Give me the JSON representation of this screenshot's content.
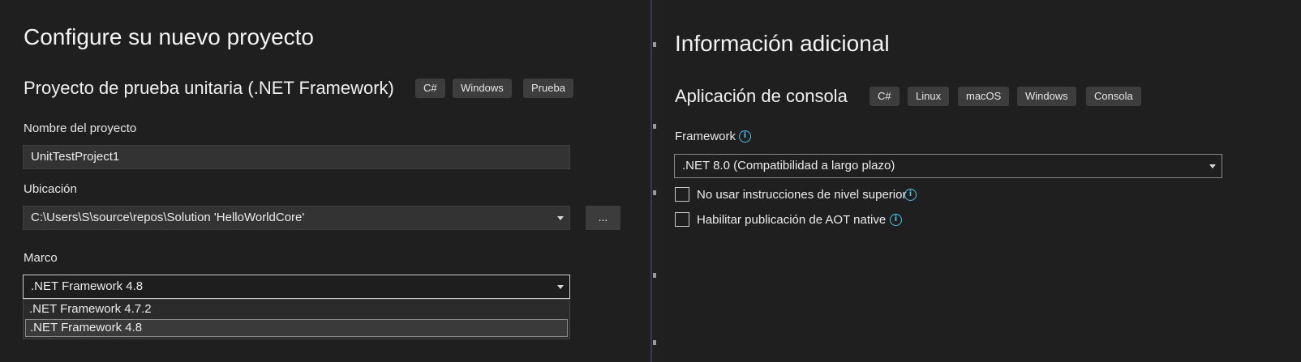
{
  "left": {
    "title": "Configure su nuevo proyecto",
    "template_name": "Proyecto de prueba unitaria (.NET Framework)",
    "tags": [
      "C#",
      "Windows",
      "Prueba"
    ],
    "project_name_label": "Nombre del proyecto",
    "project_name_value": "UnitTestProject1",
    "location_label": "Ubicación",
    "location_value": "C:\\Users\\S\\source\\repos\\Solution 'HelloWorldCore'",
    "browse_button": "...",
    "framework_label": "Marco",
    "framework_value": ".NET Framework 4.8",
    "framework_options": [
      ".NET Framework 4.7.2",
      ".NET Framework 4.8"
    ],
    "framework_selected_index": 1
  },
  "right": {
    "title": "Información adicional",
    "template_name": "Aplicación de consola",
    "tags": [
      "C#",
      "Linux",
      "macOS",
      "Windows",
      "Consola"
    ],
    "framework_label": "Framework",
    "framework_value": ".NET 8.0 (Compatibilidad a largo plazo)",
    "options": [
      {
        "label": "No usar instrucciones de nivel superior",
        "checked": false
      },
      {
        "label": "Habilitar publicación de AOT native",
        "checked": false
      }
    ]
  },
  "colors": {
    "background": "#1f1f1f",
    "info_icon": "#4fc1e9",
    "tag_background": "#3d3d3d"
  },
  "icons": {
    "info": "info-icon",
    "dropdown": "chevron-down-icon"
  }
}
